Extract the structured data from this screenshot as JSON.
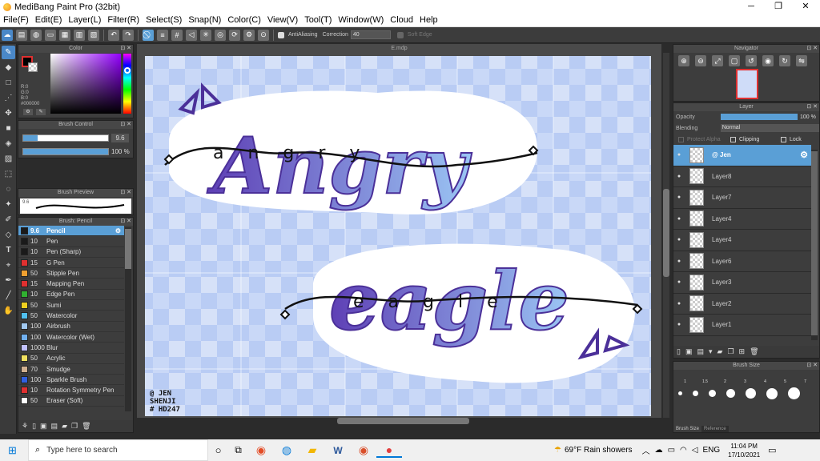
{
  "window": {
    "title": "MediBang Paint Pro (32bit)",
    "minimize": "─",
    "maximize": "❐",
    "close": "✕"
  },
  "menu": [
    "File(F)",
    "Edit(E)",
    "Layer(L)",
    "Filter(R)",
    "Select(S)",
    "Snap(N)",
    "Color(C)",
    "View(V)",
    "Tool(T)",
    "Window(W)",
    "Cloud",
    "Help"
  ],
  "toolbar": {
    "antialiasing": "AntiAliasing",
    "correction_label": "Correction",
    "correction_value": "40",
    "soft_edge": "Soft Edge"
  },
  "canvas": {
    "doc_title": "E.mdp",
    "watermark_lines": [
      "@ JEN",
      "SHENJI",
      "# HD247"
    ],
    "art_word_1": "Angry",
    "art_word_2": "eagle",
    "script_1": "angry",
    "script_2": "eagle"
  },
  "color_panel": {
    "title": "Color",
    "r": "R:0",
    "g": "G:0",
    "b": "B:0",
    "hex": "#000000",
    "fg": "#000000",
    "accent": "#4a88c8"
  },
  "brush_control": {
    "title": "Brush Control",
    "size": "9.6",
    "opacity": "100 %"
  },
  "brush_preview": {
    "title": "Brush Preview",
    "size": "9.6"
  },
  "brush_list": {
    "title": "Brush: Pencil",
    "items": [
      {
        "size": "9.6",
        "name": "Pencil",
        "color": "#1a1a1a"
      },
      {
        "size": "10",
        "name": "Pen",
        "color": "#1a1a1a"
      },
      {
        "size": "10",
        "name": "Pen (Sharp)",
        "color": "#1a1a1a"
      },
      {
        "size": "15",
        "name": "G Pen",
        "color": "#e03030"
      },
      {
        "size": "50",
        "name": "Stipple Pen",
        "color": "#f0a030"
      },
      {
        "size": "15",
        "name": "Mapping Pen",
        "color": "#e03030"
      },
      {
        "size": "10",
        "name": "Edge Pen",
        "color": "#30b030"
      },
      {
        "size": "50",
        "name": "Sumi",
        "color": "#f0d020"
      },
      {
        "size": "50",
        "name": "Watercolor",
        "color": "#50c0f0"
      },
      {
        "size": "100",
        "name": "Airbrush",
        "color": "#a0c8f0"
      },
      {
        "size": "100",
        "name": "Watercolor (Wet)",
        "color": "#70b0f0"
      },
      {
        "size": "1000",
        "name": "Blur",
        "color": "#c0c0ff"
      },
      {
        "size": "50",
        "name": "Acrylic",
        "color": "#f0e060"
      },
      {
        "size": "70",
        "name": "Smudge",
        "color": "#d0b090"
      },
      {
        "size": "100",
        "name": "Sparkle Brush",
        "color": "#3060e0"
      },
      {
        "size": "10",
        "name": "Rotation Symmetry Pen",
        "color": "#e03030"
      },
      {
        "size": "50",
        "name": "Eraser (Soft)",
        "color": "#ffffff"
      }
    ]
  },
  "navigator": {
    "title": "Navigator"
  },
  "layer_panel": {
    "title": "Layer",
    "opacity_label": "Opacity",
    "opacity_value": "100 %",
    "blending_label": "Blending",
    "blending_value": "Normal",
    "protect_alpha": "Protect Alpha",
    "clipping": "Clipping",
    "lock": "Lock",
    "layers": [
      "@ Jen",
      "Layer8",
      "Layer7",
      "Layer4",
      "Layer4",
      "Layer6",
      "Layer3",
      "Layer2",
      "Layer1"
    ]
  },
  "brush_size": {
    "title": "Brush Size",
    "labels": [
      "1",
      "1.5",
      "2",
      "3",
      "4",
      "5",
      "7"
    ],
    "tab_1": "Brush Size",
    "tab_2": "Reference"
  },
  "taskbar": {
    "search_placeholder": "Type here to search",
    "weather": "69°F  Rain showers",
    "lang": "ENG",
    "time": "11:04 PM",
    "date": "17/10/2021"
  }
}
